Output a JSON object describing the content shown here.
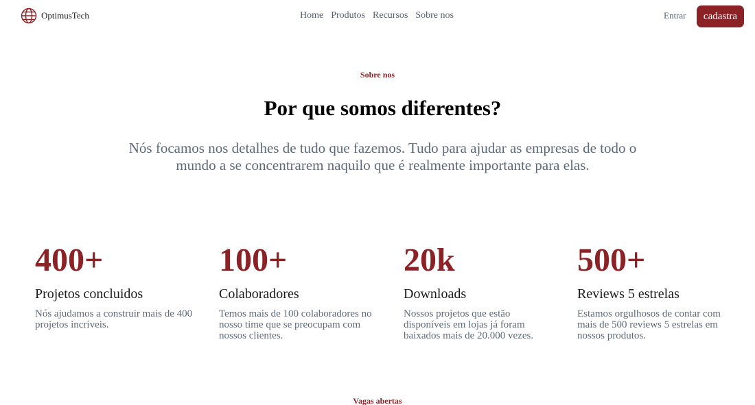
{
  "header": {
    "brand_name": "OptimusTech",
    "logo_icon": "globe-icon",
    "nav": [
      "Home",
      "Produtos",
      "Recursos",
      "Sobre nos"
    ],
    "login_label": "Entrar",
    "signup_label": "cadastra"
  },
  "about": {
    "eyebrow": "Sobre nos",
    "title": "Por que somos diferentes?",
    "lead": "Nós focamos nos detalhes de tudo que fazemos. Tudo para ajudar as empresas de todo o mundo a se concentrarem naquilo que é realmente importante para elas."
  },
  "stats": [
    {
      "value": "400+",
      "label": "Projetos concluidos",
      "desc": "Nós ajudamos a construir mais de 400 projetos incríveis."
    },
    {
      "value": "100+",
      "label": "Colaboradores",
      "desc": "Temos mais de 100 colaboradores no nosso time que se preocupam com nossos clientes."
    },
    {
      "value": "20k",
      "label": "Downloads",
      "desc": "Nossos projetos que estão disponíveis em lojas já foram baixados mais de 20.000 vezes."
    },
    {
      "value": "500+",
      "label": "Reviews 5 estrelas",
      "desc": "Estamos orgulhosos de contar com mais de 500 reviews 5 estrelas em nossos produtos."
    }
  ],
  "jobs": {
    "eyebrow": "Vagas abertas"
  },
  "colors": {
    "accent": "#8b2326",
    "muted_text": "#5e6a79",
    "nav_text": "#555e6b"
  }
}
